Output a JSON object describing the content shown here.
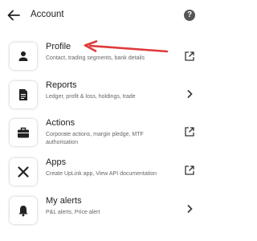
{
  "header": {
    "title": "Account",
    "back_icon": "back-arrow-icon",
    "help_icon": "help-icon",
    "help_glyph": "?"
  },
  "items": [
    {
      "label": "Profile",
      "description": "Contact, trading segments, bank details",
      "icon": "person-icon",
      "trailing": "open-external-icon"
    },
    {
      "label": "Reports",
      "description": "Ledger, profit & loss, holdings, trade",
      "icon": "document-icon",
      "trailing": "chevron-right-icon"
    },
    {
      "label": "Actions",
      "description": "Corporate actions, margin pledge, MTF authorisation",
      "icon": "briefcase-icon",
      "trailing": "open-external-icon"
    },
    {
      "label": "Apps",
      "description": "Create UpLink app, View API documentation",
      "icon": "tools-icon",
      "trailing": "open-external-icon"
    },
    {
      "label": "My alerts",
      "description": "P&L alerts, Price alert",
      "icon": "bell-icon",
      "trailing": "chevron-right-icon"
    }
  ],
  "annotation": {
    "color": "#e03a3a",
    "icon": "red-arrow-annotation"
  }
}
